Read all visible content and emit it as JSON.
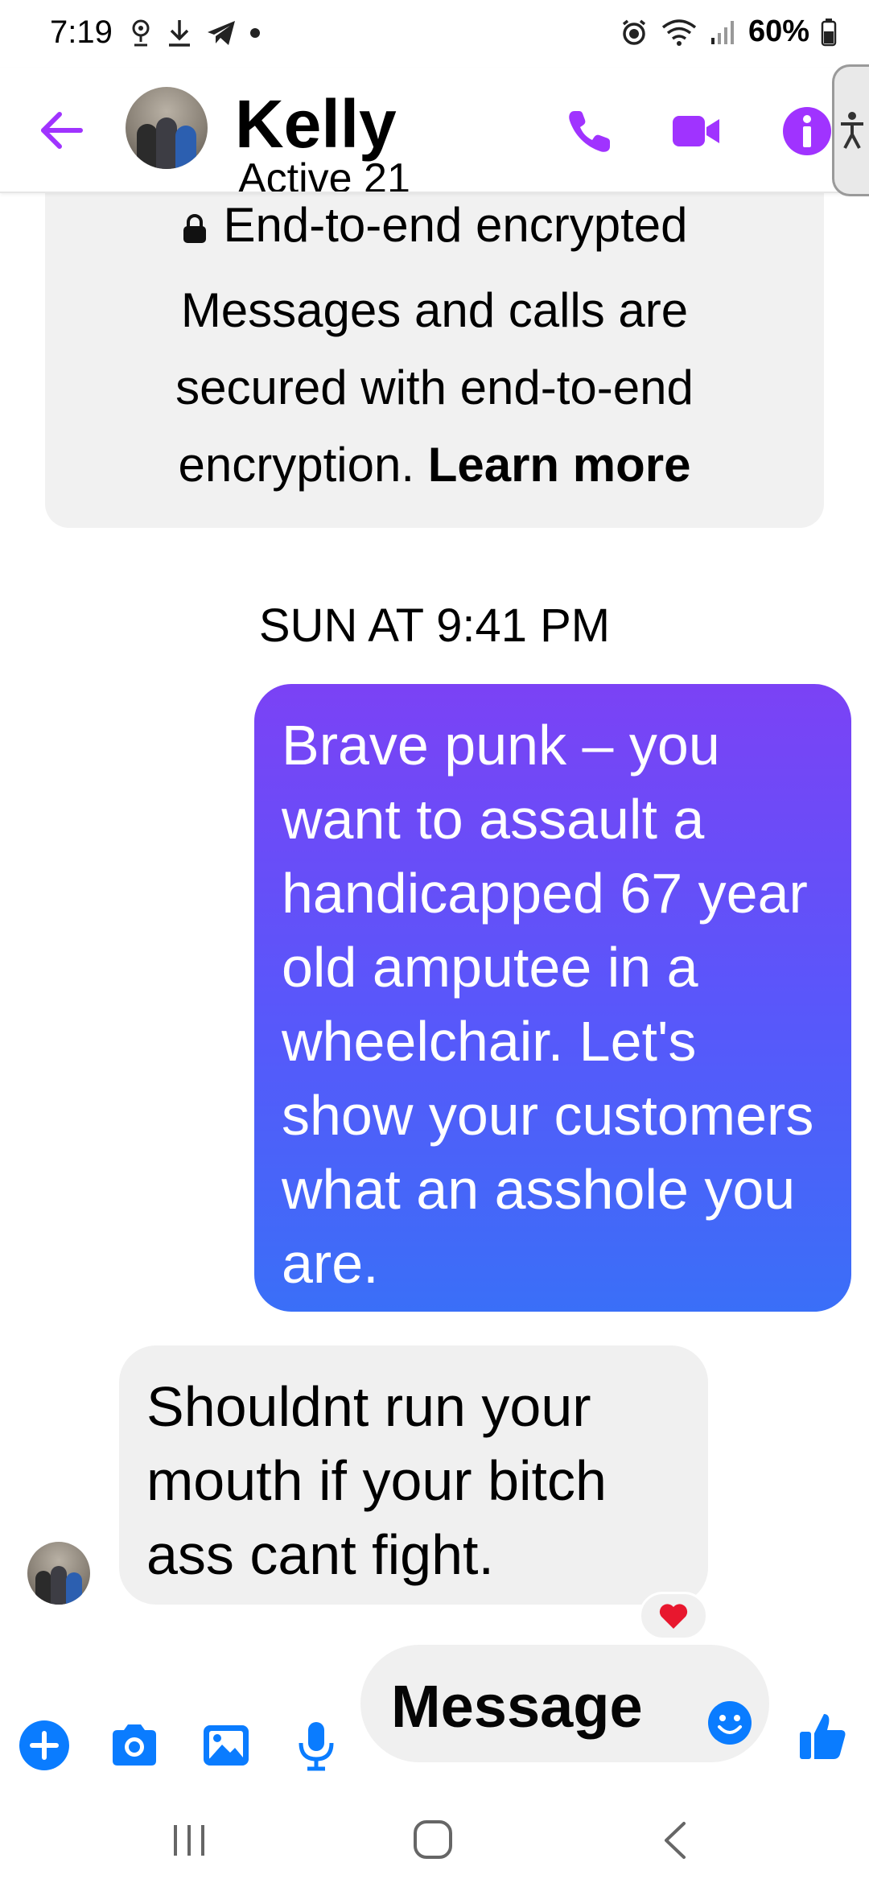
{
  "status_bar": {
    "time": "7:19",
    "battery": "60%"
  },
  "header": {
    "contact_name": "Kelly",
    "contact_status": "Active 21",
    "accent_color": "#a033ff"
  },
  "encryption_notice": {
    "title": "End-to-end encrypted",
    "body": "Messages and calls are secured with end-to-end encryption.",
    "link": "Learn more"
  },
  "conversation": {
    "timestamp": "SUN AT 9:41 PM",
    "messages": [
      {
        "direction": "outgoing",
        "text": "Brave punk – you want to assault a handicapped 67 year old amputee in a wheelchair. Let's show your customers what an asshole you are."
      },
      {
        "direction": "incoming",
        "text": "Shouldnt run your mouth if your bitch ass cant fight.",
        "reaction": "heart"
      }
    ]
  },
  "composer": {
    "placeholder": "Message",
    "icon_color": "#0a7cff"
  }
}
